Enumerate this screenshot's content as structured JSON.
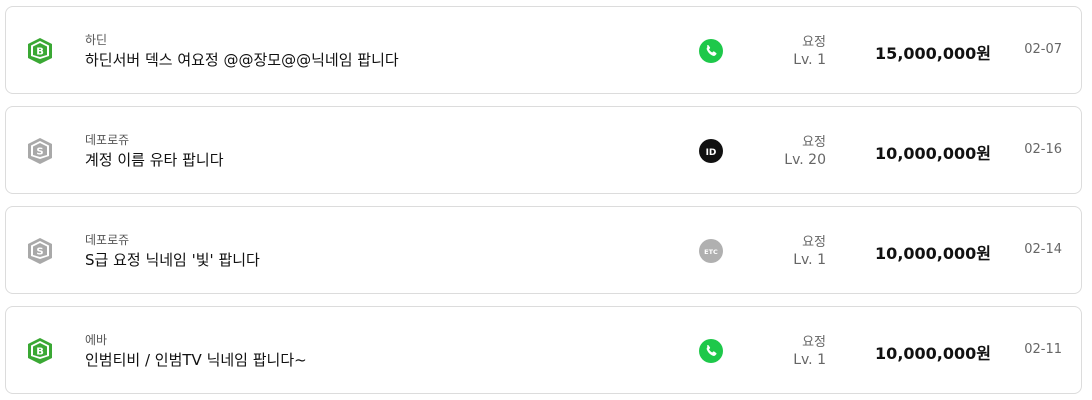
{
  "colors": {
    "badge_b": "#3aa834",
    "badge_s": "#a9a9a9",
    "phone": "#1ec84a",
    "id_badge": "#111111",
    "etc_badge": "#b0b0b0",
    "border": "#dcdcdc"
  },
  "listings": [
    {
      "badge_letter": "B",
      "badge_type": "b",
      "server": "하딘",
      "title": "하딘서버 덱스 여요정 @@장모@@닉네임 팝니다",
      "contact_icon": "phone-icon",
      "job": "요정",
      "level": "Lv. 1",
      "price": "15,000,000원",
      "date": "02-07"
    },
    {
      "badge_letter": "S",
      "badge_type": "s",
      "server": "데포로쥬",
      "title": "계정 이름 유타 팝니다",
      "contact_icon": "id-icon",
      "contact_label": "ID",
      "job": "요정",
      "level": "Lv. 20",
      "price": "10,000,000원",
      "date": "02-16"
    },
    {
      "badge_letter": "S",
      "badge_type": "s",
      "server": "데포로쥬",
      "title": "S급 요정 닉네임 '빛' 팝니다",
      "contact_icon": "etc-icon",
      "contact_label": "ETC",
      "job": "요정",
      "level": "Lv. 1",
      "price": "10,000,000원",
      "date": "02-14"
    },
    {
      "badge_letter": "B",
      "badge_type": "b",
      "server": "에바",
      "title": "인범티비 / 인범TV 닉네임 팝니다~",
      "contact_icon": "phone-icon",
      "job": "요정",
      "level": "Lv. 1",
      "price": "10,000,000원",
      "date": "02-11"
    }
  ]
}
